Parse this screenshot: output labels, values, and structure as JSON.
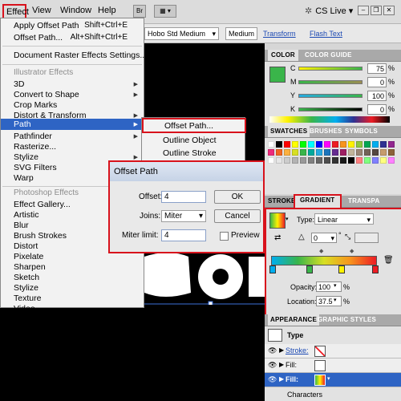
{
  "menubar": {
    "effect": "Effect",
    "view": "View",
    "window": "Window",
    "help": "Help",
    "br_icon": "Br",
    "cs_live": "CS Live"
  },
  "controlbar": {
    "font_family": "Hobo Std Medium",
    "font_style": "Medium",
    "transform": "Transform",
    "flash_text": "Flash Text"
  },
  "effect_menu": {
    "apply_offset": "Apply Offset Path",
    "apply_offset_shortcut": "Shift+Ctrl+E",
    "offset_path": "Offset Path...",
    "offset_path_shortcut": "Alt+Shift+Ctrl+E",
    "raster_settings": "Document Raster Effects Settings...",
    "illustrator_effects": "Illustrator Effects",
    "items": [
      "3D",
      "Convert to Shape",
      "Crop Marks",
      "Distort & Transform",
      "Path",
      "Pathfinder",
      "Rasterize...",
      "Stylize",
      "SVG Filters",
      "Warp"
    ],
    "photoshop_effects": "Photoshop Effects",
    "ps_items": [
      "Effect Gallery...",
      "Artistic",
      "Blur",
      "Brush Strokes",
      "Distort",
      "Pixelate",
      "Sharpen",
      "Sketch",
      "Stylize",
      "Texture",
      "Video"
    ]
  },
  "path_submenu": {
    "items": [
      "Offset Path...",
      "Outline Object",
      "Outline Stroke"
    ]
  },
  "offset_dialog": {
    "title": "Offset Path",
    "offset_label": "Offset:",
    "offset_value": "4",
    "joins_label": "Joins:",
    "joins_value": "Miter",
    "miter_label": "Miter limit:",
    "miter_value": "4",
    "ok": "OK",
    "cancel": "Cancel",
    "preview": "Preview"
  },
  "color_panel": {
    "tab_color": "COLOR",
    "tab_guide": "COLOR GUIDE",
    "channels": [
      {
        "label": "C",
        "value": "75",
        "level": 0.75
      },
      {
        "label": "M",
        "value": "0",
        "level": 0
      },
      {
        "label": "Y",
        "value": "100",
        "level": 1.0
      },
      {
        "label": "K",
        "value": "0",
        "level": 0
      }
    ],
    "swatch_color": "#3ab54a"
  },
  "swatches_panel": {
    "tabs": [
      "SWATCHES",
      "BRUSHES",
      "SYMBOLS"
    ],
    "colors": [
      "#ffffff",
      "#000000",
      "#ff0000",
      "#ffff00",
      "#00ff00",
      "#00ffff",
      "#0000ff",
      "#ff00ff",
      "#ed1c24",
      "#f7941d",
      "#fff200",
      "#8dc63f",
      "#00a651",
      "#00aeef",
      "#2e3192",
      "#92278f",
      "#ee2a7b",
      "#f26522",
      "#fbb040",
      "#d7df23",
      "#39b54a",
      "#00a99d",
      "#27aae1",
      "#1c75bc",
      "#662d91",
      "#9e1f63",
      "#c2b59b",
      "#998675",
      "#736357",
      "#534741",
      "#c69c6d",
      "#8c6239",
      "#ffffff",
      "#e6e6e6",
      "#cccccc",
      "#b3b3b3",
      "#999999",
      "#808080",
      "#666666",
      "#4d4d4d",
      "#333333",
      "#1a1a1a",
      "#000000",
      "#ff8080",
      "#80ff80",
      "#8080ff",
      "#ffff80",
      "#ff80ff"
    ]
  },
  "gradient_panel": {
    "tabs": [
      "STROKE",
      "GRADIENT",
      "TRANSPA"
    ],
    "type_label": "Type:",
    "type_value": "Linear",
    "angle_value": "0",
    "degree_symbol": "°",
    "opacity_label": "Opacity:",
    "opacity_value": "100",
    "location_label": "Location:",
    "location_value": "37.5",
    "percent": "%"
  },
  "appearance_panel": {
    "tabs": [
      "APPEARANCE",
      "GRAPHIC STYLES"
    ],
    "type_label": "Type",
    "stroke_label": "Stroke:",
    "fill_label": "Fill:",
    "fill2_label": "Fill:",
    "characters_label": "Characters"
  }
}
